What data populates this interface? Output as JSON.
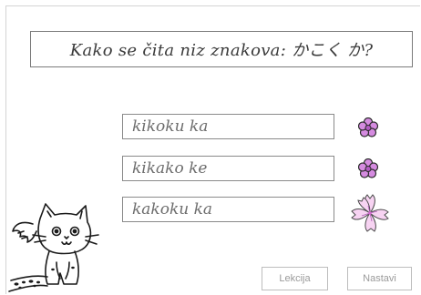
{
  "question": {
    "text": "Kako se čita niz znakova: かこく か?"
  },
  "answers": [
    {
      "text": "kikoku ka"
    },
    {
      "text": "kikako ke"
    },
    {
      "text": "kakoku ka"
    }
  ],
  "buttons": {
    "lesson": "Lekcija",
    "next": "Nastavi"
  },
  "icons": {
    "answer_markers": [
      "flower-bud-icon",
      "flower-bud-icon",
      "cherry-blossom-icon"
    ],
    "mascot": "cat-mascot-illustration"
  },
  "colors": {
    "flower_fill": "#d58be0",
    "blossom_fill": "#f7d3f2",
    "border": "#8a8a8a"
  }
}
